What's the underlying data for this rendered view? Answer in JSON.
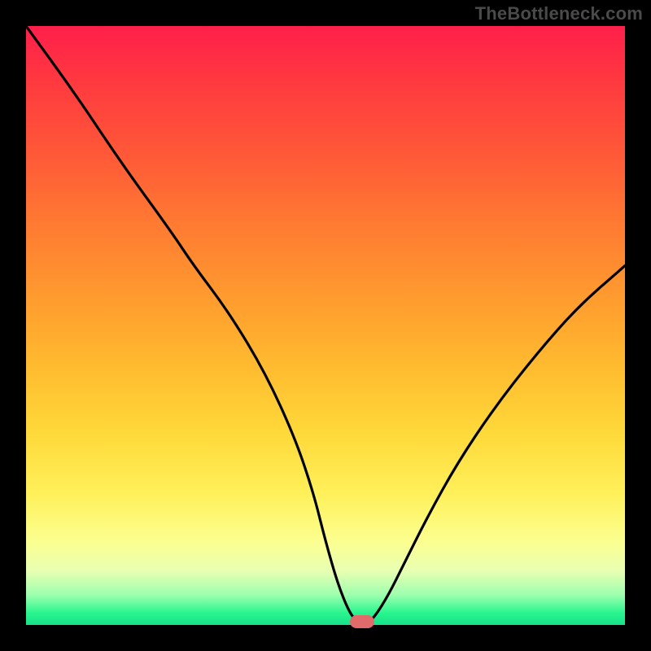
{
  "watermark": "TheBottleneck.com",
  "chart_data": {
    "type": "line",
    "title": "",
    "xlabel": "",
    "ylabel": "",
    "xlim": [
      0,
      100
    ],
    "ylim": [
      0,
      100
    ],
    "grid": false,
    "legend": false,
    "series": [
      {
        "name": "curve",
        "x": [
          0,
          8,
          16,
          24,
          28,
          34,
          40,
          45,
          48,
          50,
          52,
          54,
          55.5,
          57,
          58.3,
          60.5,
          63,
          67,
          72,
          78,
          85,
          92,
          100
        ],
        "values": [
          100,
          89,
          77,
          66,
          60,
          52,
          42,
          31,
          22,
          14,
          7,
          2,
          0.3,
          0.3,
          1.5,
          5,
          10,
          18,
          27,
          36,
          45,
          53,
          60
        ]
      }
    ],
    "marker": {
      "x": 56.1,
      "y": 0.0,
      "color": "#e16a6a"
    },
    "background_gradient_stops": [
      {
        "pos": 0.0,
        "color": "#ff1f4b"
      },
      {
        "pos": 0.5,
        "color": "#ffbb2f"
      },
      {
        "pos": 0.8,
        "color": "#fff05a"
      },
      {
        "pos": 1.0,
        "color": "#16e28a"
      }
    ]
  }
}
